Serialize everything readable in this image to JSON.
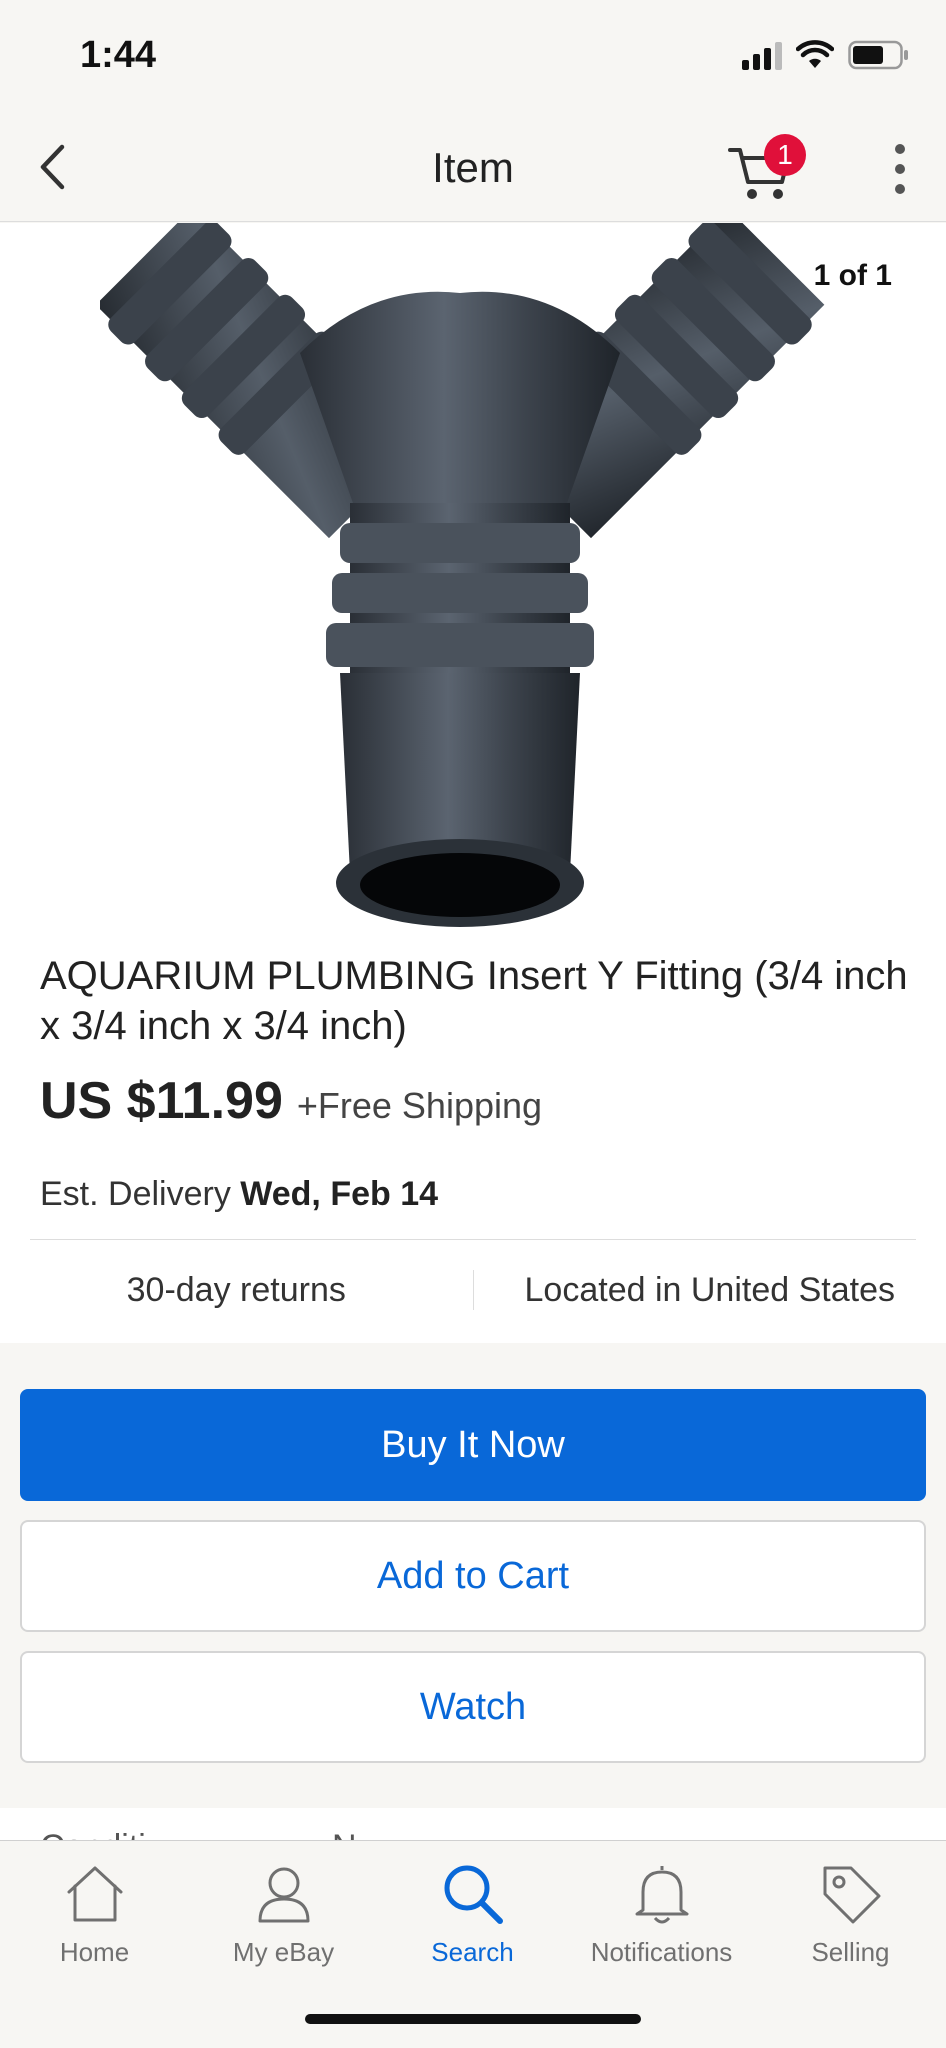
{
  "status_bar": {
    "time": "1:44"
  },
  "nav": {
    "title": "Item",
    "cart_count": "1"
  },
  "product": {
    "image_counter": "1 of 1",
    "title": "AQUARIUM PLUMBING Insert Y Fitting (3/4 inch x 3/4 inch x 3/4 inch)",
    "price": "US $11.99",
    "shipping": "+Free Shipping",
    "delivery_label": "Est. Delivery",
    "delivery_date": "Wed, Feb 14",
    "returns": "30-day returns",
    "location": "Located in United States"
  },
  "actions": {
    "buy_now": "Buy It Now",
    "add_to_cart": "Add to Cart",
    "watch": "Watch"
  },
  "peek": {
    "left": "Conditi...",
    "right": "N..."
  },
  "tabs": [
    {
      "label": "Home",
      "icon": "home-icon",
      "active": false
    },
    {
      "label": "My eBay",
      "icon": "person-icon",
      "active": false
    },
    {
      "label": "Search",
      "icon": "search-icon",
      "active": true
    },
    {
      "label": "Notifications",
      "icon": "bell-icon",
      "active": false
    },
    {
      "label": "Selling",
      "icon": "tag-icon",
      "active": false
    }
  ],
  "colors": {
    "accent": "#0968d8",
    "badge": "#e0103a",
    "image_bg": "#ffffff"
  }
}
